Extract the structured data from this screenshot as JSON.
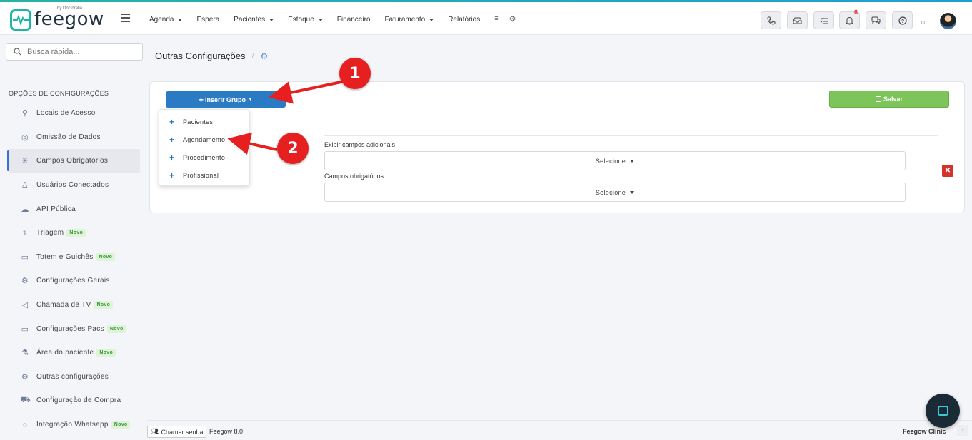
{
  "app": {
    "logo_text": "feegow",
    "logo_sub": "by Doctoralia"
  },
  "menu": [
    {
      "label": "Agenda",
      "dropdown": true
    },
    {
      "label": "Espera",
      "dropdown": false
    },
    {
      "label": "Pacientes",
      "dropdown": true
    },
    {
      "label": "Estoque",
      "dropdown": true
    },
    {
      "label": "Financeiro",
      "dropdown": false
    },
    {
      "label": "Faturamento",
      "dropdown": true
    },
    {
      "label": "Relatórios",
      "dropdown": false
    }
  ],
  "topbar": {
    "notifications_count": "6",
    "icons": [
      "phone-icon",
      "inbox-icon",
      "checklist-icon",
      "bell-icon",
      "chat-icon",
      "help-icon"
    ]
  },
  "search": {
    "placeholder": "Busca rápida..."
  },
  "sidebar": {
    "title": "OPÇÕES DE CONFIGURAÇÕES",
    "items": [
      {
        "label": "Locais de Acesso",
        "icon": "pin-icon",
        "glyph": "⚲",
        "novo": false,
        "active": false
      },
      {
        "label": "Omissão de Dados",
        "icon": "eye-off-icon",
        "glyph": "◎",
        "novo": false,
        "active": false
      },
      {
        "label": "Campos Obrigatórios",
        "icon": "asterisk-icon",
        "glyph": "✳",
        "novo": false,
        "active": true
      },
      {
        "label": "Usuários Conectados",
        "icon": "user-icon",
        "glyph": "♙",
        "novo": false,
        "active": false
      },
      {
        "label": "API Pública",
        "icon": "cloud-icon",
        "glyph": "☁",
        "novo": false,
        "active": false
      },
      {
        "label": "Triagem",
        "icon": "stethoscope-icon",
        "glyph": "⚕",
        "novo": true,
        "active": false
      },
      {
        "label": "Totem e Guichês",
        "icon": "laptop-icon",
        "glyph": "▭",
        "novo": true,
        "active": false
      },
      {
        "label": "Configurações Gerais",
        "icon": "gears-icon",
        "glyph": "⚙",
        "novo": false,
        "active": false
      },
      {
        "label": "Chamada de TV",
        "icon": "megaphone-icon",
        "glyph": "◁",
        "novo": true,
        "active": false
      },
      {
        "label": "Configurações Pacs",
        "icon": "laptop-icon",
        "glyph": "▭",
        "novo": true,
        "active": false
      },
      {
        "label": "Área do paciente",
        "icon": "flask-icon",
        "glyph": "⚗",
        "novo": true,
        "active": false
      },
      {
        "label": "Outras configurações",
        "icon": "gears-icon",
        "glyph": "⚙",
        "novo": false,
        "active": false
      },
      {
        "label": "Configuração de Compra",
        "icon": "cart-icon",
        "glyph": "⛟",
        "novo": false,
        "active": false
      },
      {
        "label": "Integração Whatsapp",
        "icon": "whatsapp-icon",
        "glyph": "◌",
        "novo": true,
        "active": false
      }
    ],
    "novo_label": "Novo"
  },
  "breadcrumb": {
    "title": "Outras Configurações"
  },
  "panel": {
    "insert_button": "Inserir Grupo",
    "save_button": "Salvar",
    "field1_label": "Exibir campos adicionais",
    "field1_value": "Selecione",
    "field2_label": "Campos obrigatórios",
    "field2_value": "Selecione",
    "delete_glyph": "✕"
  },
  "dropdown": {
    "items": [
      "Pacientes",
      "Agendamento",
      "Procedimento",
      "Profissional"
    ]
  },
  "footer": {
    "call_button": "Chamar senha",
    "version": "Feegow 8.0",
    "clinic": "Feegow Clinic"
  },
  "annotations": {
    "label1": "1",
    "label2": "2",
    "color": "#e62020"
  }
}
